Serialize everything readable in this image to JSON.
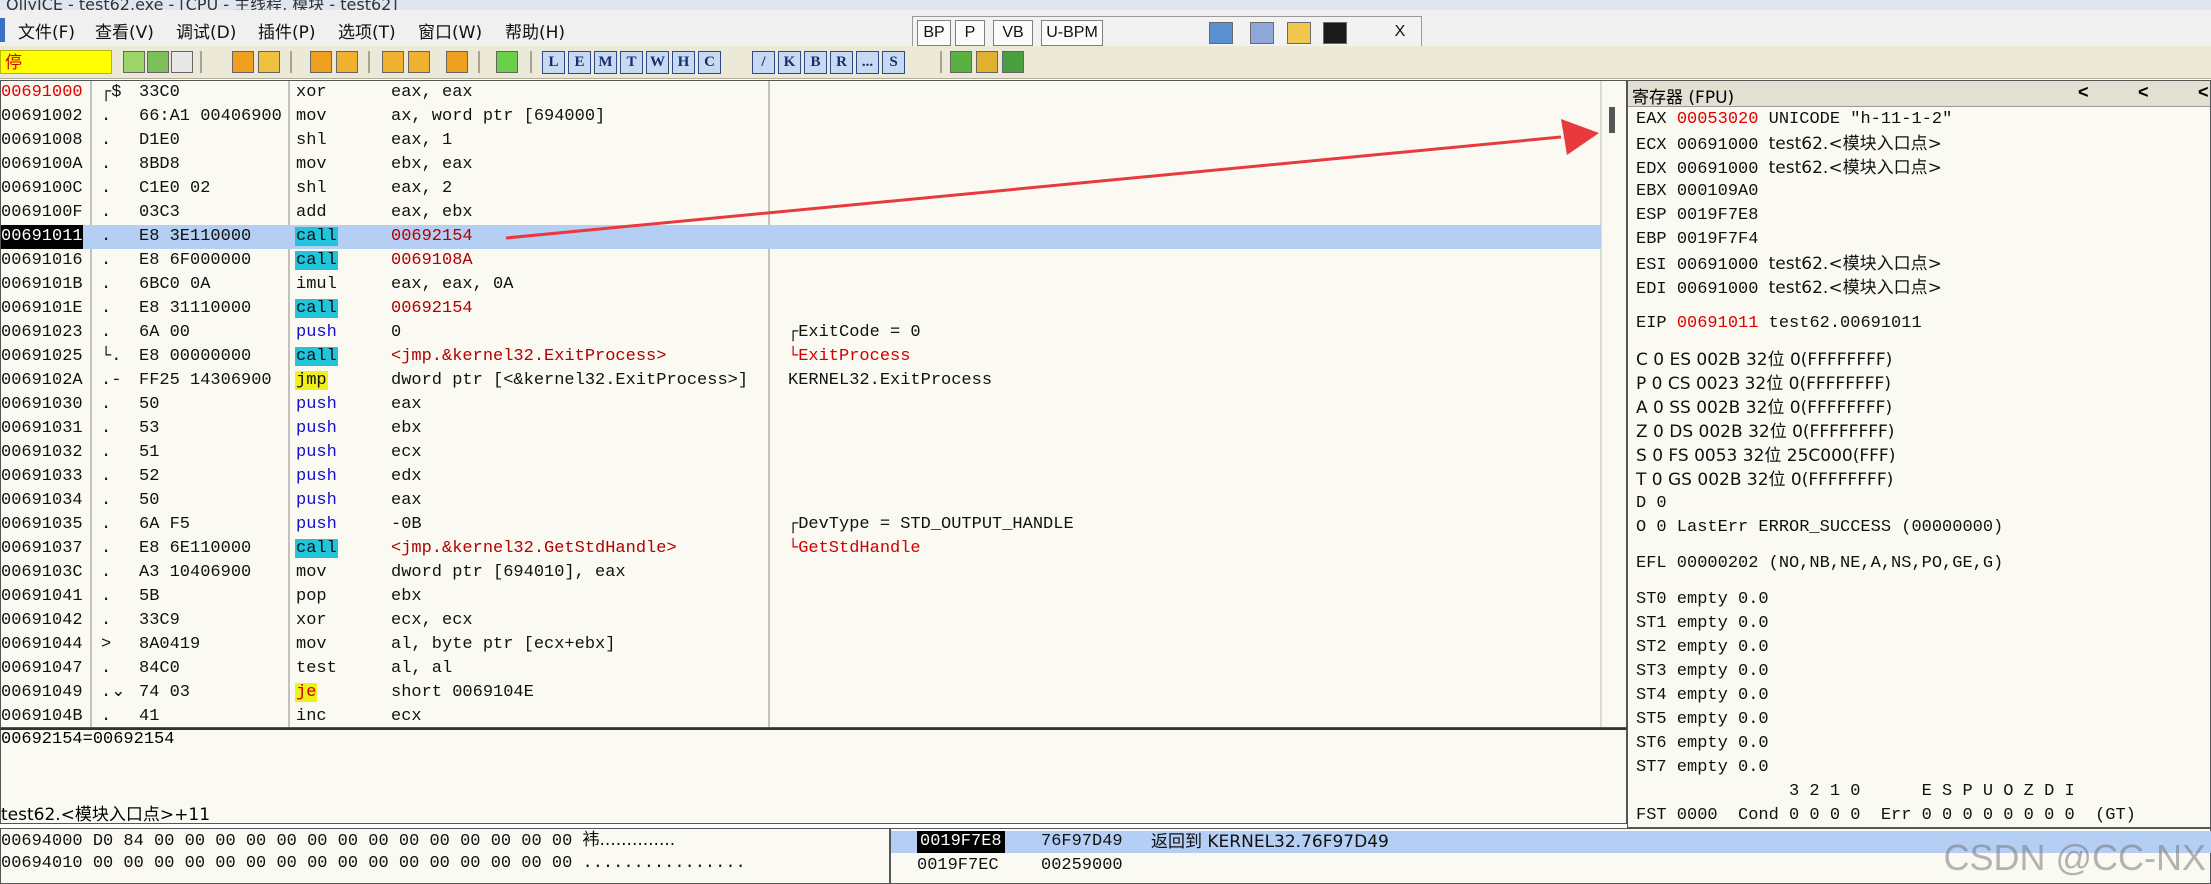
{
  "title_bar": {
    "text": "OllyICE - test62.exe - [CPU - 主线程, 模块 - test62]"
  },
  "menu": [
    {
      "label": "文件(F)"
    },
    {
      "label": "查看(V)"
    },
    {
      "label": "调试(D)"
    },
    {
      "label": "插件(P)"
    },
    {
      "label": "选项(T)"
    },
    {
      "label": "窗口(W)"
    },
    {
      "label": "帮助(H)"
    }
  ],
  "quickbar": {
    "buttons": [
      {
        "label": "BP"
      },
      {
        "label": "P"
      },
      {
        "label": "VB"
      },
      {
        "label": "U-BPM"
      }
    ],
    "close": "X"
  },
  "toolbar": {
    "status": "停",
    "letters": [
      "L",
      "E",
      "M",
      "T",
      "W",
      "H",
      "C",
      "/",
      "K",
      "B",
      "R",
      "...",
      "S"
    ]
  },
  "disasm": {
    "rows": [
      {
        "addr": "00691000",
        "mark": "┌$",
        "hex": "33C0",
        "mnemonic": "xor",
        "operand": "eax, eax",
        "comment": ""
      },
      {
        "addr": "00691002",
        "mark": ".",
        "hex": "66:A1 00406900",
        "mnemonic": "mov",
        "operand": "ax, word ptr [694000]",
        "comment": ""
      },
      {
        "addr": "00691008",
        "mark": ".",
        "hex": "D1E0",
        "mnemonic": "shl",
        "operand": "eax, 1",
        "comment": ""
      },
      {
        "addr": "0069100A",
        "mark": ".",
        "hex": "8BD8",
        "mnemonic": "mov",
        "operand": "ebx, eax",
        "comment": ""
      },
      {
        "addr": "0069100C",
        "mark": ".",
        "hex": "C1E0 02",
        "mnemonic": "shl",
        "operand": "eax, 2",
        "comment": ""
      },
      {
        "addr": "0069100F",
        "mark": ".",
        "hex": "03C3",
        "mnemonic": "add",
        "operand": "eax, ebx",
        "comment": ""
      },
      {
        "addr": "00691011",
        "mark": ".",
        "hex": "E8 3E110000",
        "mnemonic": "call",
        "operand": "00692154",
        "comment": ""
      },
      {
        "addr": "00691016",
        "mark": ".",
        "hex": "E8 6F000000",
        "mnemonic": "call",
        "operand": "0069108A",
        "comment": ""
      },
      {
        "addr": "0069101B",
        "mark": ".",
        "hex": "6BC0 0A",
        "mnemonic": "imul",
        "operand": "eax, eax, 0A",
        "comment": ""
      },
      {
        "addr": "0069101E",
        "mark": ".",
        "hex": "E8 31110000",
        "mnemonic": "call",
        "operand": "00692154",
        "comment": ""
      },
      {
        "addr": "00691023",
        "mark": ".",
        "hex": "6A 00",
        "mnemonic": "push",
        "operand": "0",
        "comment": "┌ExitCode = 0"
      },
      {
        "addr": "00691025",
        "mark": "└.",
        "hex": "E8 00000000",
        "mnemonic": "call",
        "operand": "<jmp.&kernel32.ExitProcess>",
        "comment": "└ExitProcess"
      },
      {
        "addr": "0069102A",
        "mark": ".-",
        "hex": "FF25 14306900",
        "mnemonic": "jmp",
        "operand": "dword ptr [<&kernel32.ExitProcess>]",
        "comment": "KERNEL32.ExitProcess"
      },
      {
        "addr": "00691030",
        "mark": ".",
        "hex": "50",
        "mnemonic": "push",
        "operand": "eax",
        "comment": ""
      },
      {
        "addr": "00691031",
        "mark": ".",
        "hex": "53",
        "mnemonic": "push",
        "operand": "ebx",
        "comment": ""
      },
      {
        "addr": "00691032",
        "mark": ".",
        "hex": "51",
        "mnemonic": "push",
        "operand": "ecx",
        "comment": ""
      },
      {
        "addr": "00691033",
        "mark": ".",
        "hex": "52",
        "mnemonic": "push",
        "operand": "edx",
        "comment": ""
      },
      {
        "addr": "00691034",
        "mark": ".",
        "hex": "50",
        "mnemonic": "push",
        "operand": "eax",
        "comment": ""
      },
      {
        "addr": "00691035",
        "mark": ".",
        "hex": "6A F5",
        "mnemonic": "push",
        "operand": "-0B",
        "comment": "┌DevType = STD_OUTPUT_HANDLE"
      },
      {
        "addr": "00691037",
        "mark": ".",
        "hex": "E8 6E110000",
        "mnemonic": "call",
        "operand": "<jmp.&kernel32.GetStdHandle>",
        "comment": "└GetStdHandle"
      },
      {
        "addr": "0069103C",
        "mark": ".",
        "hex": "A3 10406900",
        "mnemonic": "mov",
        "operand": "dword ptr [694010], eax",
        "comment": ""
      },
      {
        "addr": "00691041",
        "mark": ".",
        "hex": "5B",
        "mnemonic": "pop",
        "operand": "ebx",
        "comment": ""
      },
      {
        "addr": "00691042",
        "mark": ".",
        "hex": "33C9",
        "mnemonic": "xor",
        "operand": "ecx, ecx",
        "comment": ""
      },
      {
        "addr": "00691044",
        "mark": ">",
        "hex": "8A0419",
        "mnemonic": "mov",
        "operand": "al, byte ptr [ecx+ebx]",
        "comment": ""
      },
      {
        "addr": "00691047",
        "mark": ".",
        "hex": "84C0",
        "mnemonic": "test",
        "operand": "al, al",
        "comment": ""
      },
      {
        "addr": "00691049",
        "mark": ".⌄",
        "hex": "74 03",
        "mnemonic": "je",
        "operand": "short 0069104E",
        "comment": ""
      },
      {
        "addr": "0069104B",
        "mark": ".",
        "hex": "41",
        "mnemonic": "inc",
        "operand": "ecx",
        "comment": ""
      }
    ]
  },
  "info": {
    "line1": "00692154=00692154",
    "line2": "test62.<模块入口点>+11"
  },
  "registers": {
    "header": "寄存器 (FPU)",
    "header_arrows": [
      "<",
      "<",
      "<"
    ],
    "lines": {
      "eax": {
        "name": "EAX",
        "value": "00053020",
        "desc": "UNICODE \"h-11-1-2\""
      },
      "ecx": {
        "name": "ECX",
        "value": "00691000",
        "desc": "test62.<模块入口点>"
      },
      "edx": {
        "name": "EDX",
        "value": "00691000",
        "desc": "test62.<模块入口点>"
      },
      "ebx": {
        "name": "EBX",
        "value": "000109A0",
        "desc": ""
      },
      "esp": {
        "name": "ESP",
        "value": "0019F7E8",
        "desc": ""
      },
      "ebp": {
        "name": "EBP",
        "value": "0019F7F4",
        "desc": ""
      },
      "esi": {
        "name": "ESI",
        "value": "00691000",
        "desc": "test62.<模块入口点>"
      },
      "edi": {
        "name": "EDI",
        "value": "00691000",
        "desc": "test62.<模块入口点>"
      },
      "eip": {
        "name": "EIP",
        "value": "00691011",
        "desc": "test62.00691011"
      }
    },
    "flags": [
      "C 0  ES 002B 32位 0(FFFFFFFF)",
      "P 0  CS 0023 32位 0(FFFFFFFF)",
      "A 0  SS 002B 32位 0(FFFFFFFF)",
      "Z 0  DS 002B 32位 0(FFFFFFFF)",
      "S 0  FS 0053 32位 25C000(FFF)",
      "T 0  GS 002B 32位 0(FFFFFFFF)",
      "D 0",
      "O 0  LastErr ERROR_SUCCESS (00000000)"
    ],
    "efl": "EFL 00000202 (NO,NB,NE,A,NS,PO,GE,G)",
    "st": [
      "ST0 empty 0.0",
      "ST1 empty 0.0",
      "ST2 empty 0.0",
      "ST3 empty 0.0",
      "ST4 empty 0.0",
      "ST5 empty 0.0",
      "ST6 empty 0.0",
      "ST7 empty 0.0"
    ],
    "fst_head": "               3 2 1 0      E S P U O Z D I",
    "fst": "FST 0000  Cond 0 0 0 0  Err 0 0 0 0 0 0 0 0  (GT)"
  },
  "dump": {
    "rows": [
      {
        "addr": "00694000",
        "hex": "D0 84 00 00 00 00 00 00 00 00 00 00 00 00 00 00",
        "ascii": "袆.............."
      },
      {
        "addr": "00694010",
        "hex": "00 00 00 00 00 00 00 00 00 00 00 00 00 00 00 00",
        "ascii": "................"
      }
    ]
  },
  "stack": {
    "rows": [
      {
        "addr": "0019F7E8",
        "value": "76F97D49",
        "comment": "返回到 KERNEL32.76F97D49"
      },
      {
        "addr": "0019F7EC",
        "value": "00259000",
        "comment": ""
      }
    ]
  },
  "watermark": "CSDN @CC-NX"
}
